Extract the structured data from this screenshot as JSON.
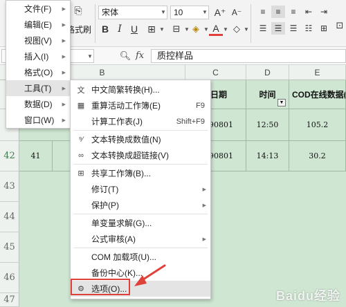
{
  "ribbon": {
    "format_painter_label": "格式刷",
    "font_name": "宋体",
    "font_size": "10",
    "font_increase": "A⁺",
    "font_decrease": "A⁻"
  },
  "formula_bar": {
    "fx_label": "fx",
    "value": "质控样品"
  },
  "grid": {
    "columns": [
      "B",
      "C",
      "D",
      "E"
    ],
    "header_row": {
      "c": "日期",
      "d": "时间",
      "e": "COD在线数据(m"
    },
    "rows": [
      {
        "c": "90801",
        "d": "12:50",
        "e": "105.2"
      },
      {
        "num": "42",
        "a": "41",
        "c": "90801",
        "d": "14:13",
        "e": "30.2"
      }
    ],
    "row_numbers": [
      "43",
      "44",
      "45",
      "46",
      "47"
    ]
  },
  "main_menu": [
    {
      "label": "文件(F)"
    },
    {
      "label": "编辑(E)"
    },
    {
      "label": "视图(V)"
    },
    {
      "label": "插入(I)"
    },
    {
      "label": "格式(O)"
    },
    {
      "label": "工具(T)"
    },
    {
      "label": "数据(D)"
    },
    {
      "label": "窗口(W)"
    }
  ],
  "tools_menu": [
    {
      "label": "中文简繁转换(H)...",
      "shortcut": ""
    },
    {
      "label": "重算活动工作簿(E)",
      "shortcut": "F9"
    },
    {
      "label": "计算工作表(J)",
      "shortcut": "Shift+F9"
    },
    {
      "label": "文本转换成数值(N)",
      "shortcut": ""
    },
    {
      "label": "文本转换成超链接(V)",
      "shortcut": ""
    },
    {
      "label": "共享工作簿(B)...",
      "shortcut": ""
    },
    {
      "label": "修订(T)",
      "shortcut": ""
    },
    {
      "label": "保护(P)",
      "shortcut": ""
    },
    {
      "label": "单变量求解(G)...",
      "shortcut": ""
    },
    {
      "label": "公式审核(A)",
      "shortcut": ""
    },
    {
      "label": "COM 加载项(U)...",
      "shortcut": ""
    },
    {
      "label": "备份中心(K)...",
      "shortcut": ""
    },
    {
      "label": "选项(O)...",
      "shortcut": ""
    }
  ],
  "watermark": "Baidu经验",
  "colors": {
    "accent": "#e0403a",
    "grid_bg": "#cfe6d2",
    "menu_active": "#e4e4e4"
  }
}
